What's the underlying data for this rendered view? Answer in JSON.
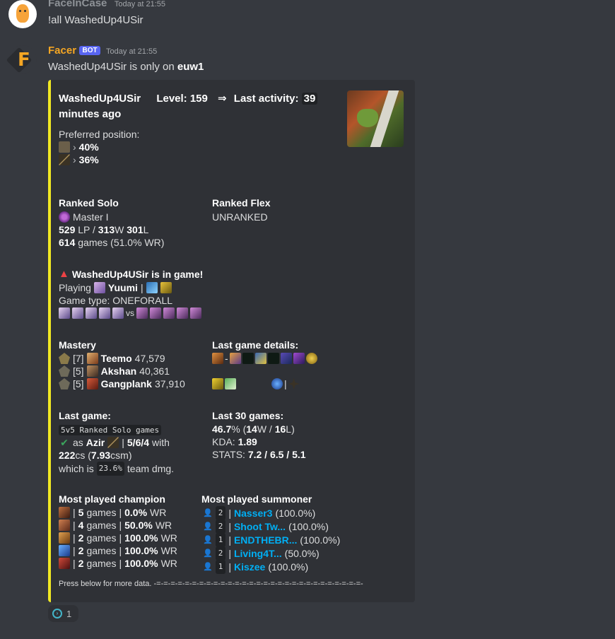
{
  "message1": {
    "username": "FaceInCase",
    "timestamp": "Today at 21:55",
    "text": "!all WashedUp4USir"
  },
  "message2": {
    "username": "Facer",
    "bot_tag": "BOT",
    "timestamp": "Today at 21:55",
    "text_prefix": "WashedUp4USir is only on ",
    "text_server": "euw1",
    "username_color": "#f5a623"
  },
  "embed": {
    "accent_color": "#f0e823",
    "title": {
      "player": "WashedUp4USir",
      "level_label": "Level:",
      "level": "159",
      "arrow": "⇒",
      "activity_label": "Last activity:",
      "activity_value": "39",
      "activity_suffix": "minutes ago"
    },
    "preferred": {
      "label": "Preferred position:",
      "positions": [
        {
          "icon": "top-lane-icon",
          "value": "40%"
        },
        {
          "icon": "mid-lane-icon",
          "value": "36%"
        }
      ]
    },
    "ranked_solo": {
      "label": "Ranked Solo",
      "tier": "Master I",
      "lp": "529",
      "lp_unit": " LP / ",
      "wins": "313",
      "w_unit": "W ",
      "losses": "301",
      "l_unit": "L",
      "games": "614",
      "games_suffix": " games (51.0% WR)"
    },
    "ranked_flex": {
      "label": "Ranked Flex",
      "value": "UNRANKED"
    },
    "ingame": {
      "title": "WashedUp4USir is in game!",
      "playing_label": "Playing",
      "champion": "Yuumi",
      "separator": "|",
      "game_type_label": "Game type: ONEFORALL",
      "vs": "vs"
    },
    "mastery": {
      "label": "Mastery",
      "items": [
        {
          "level": "[7]",
          "champ": "Teemo",
          "points": "47,579"
        },
        {
          "level": "[5]",
          "champ": "Akshan",
          "points": "40,361"
        },
        {
          "level": "[5]",
          "champ": "Gangplank",
          "points": "37,910"
        }
      ]
    },
    "last_game_details": {
      "label": "Last game details:",
      "dash": "-",
      "sep": "|"
    },
    "last_game": {
      "label": "Last game:",
      "mode": "5v5 Ranked Solo games",
      "as": "as",
      "champion": "Azir",
      "kda": "5/6/4",
      "with": "with",
      "cs": "222",
      "cs_unit": "cs (",
      "csm": "7.93",
      "csm_unit": "csm)",
      "dmg_prefix": "which is",
      "dmg": "23.6%",
      "dmg_suffix": "team dmg."
    },
    "last30": {
      "label": "Last 30 games:",
      "wr": "46.7",
      "wr_unit": "% (",
      "w": "14",
      "w_unit": "W / ",
      "l": "16",
      "l_unit": "L)",
      "kda_label": "KDA:",
      "kda": "1.89",
      "stats_label": "STATS:",
      "stats": "7.2 / 6.5 / 5.1"
    },
    "most_played_champion": {
      "label": "Most played champion",
      "rows": [
        {
          "games": "5",
          "wr": "0.0%",
          "color": "#8a4a2a"
        },
        {
          "games": "4",
          "wr": "50.0%",
          "color": "#b0602e"
        },
        {
          "games": "2",
          "wr": "100.0%",
          "color": "#c98a3b"
        },
        {
          "games": "2",
          "wr": "100.0%",
          "color": "#3a6fb5"
        },
        {
          "games": "2",
          "wr": "100.0%",
          "color": "#9c2f2a"
        }
      ],
      "games_word": "games",
      "wr_word": "WR",
      "bar": "|"
    },
    "most_played_summoner": {
      "label": "Most played summoner",
      "rows": [
        {
          "count": "2",
          "name": "Nasser3",
          "pct": "(100.0%)"
        },
        {
          "count": "2",
          "name": "Shoot Tw...",
          "pct": "(100.0%)"
        },
        {
          "count": "1",
          "name": "ENDTHEBR...",
          "pct": "(100.0%)"
        },
        {
          "count": "2",
          "name": "Living4T...",
          "pct": "(50.0%)"
        },
        {
          "count": "1",
          "name": "Kiszee",
          "pct": "(100.0%)"
        }
      ]
    },
    "footer": "Press below for more data. -=-=-=-=-=-=-=-=-=-=-=-=-=-=-=-=-=-=-=-=-=-=-=-=-=-=-=-=-=-"
  },
  "reaction": {
    "icon": "arrow-circle-icon",
    "count": "1"
  }
}
